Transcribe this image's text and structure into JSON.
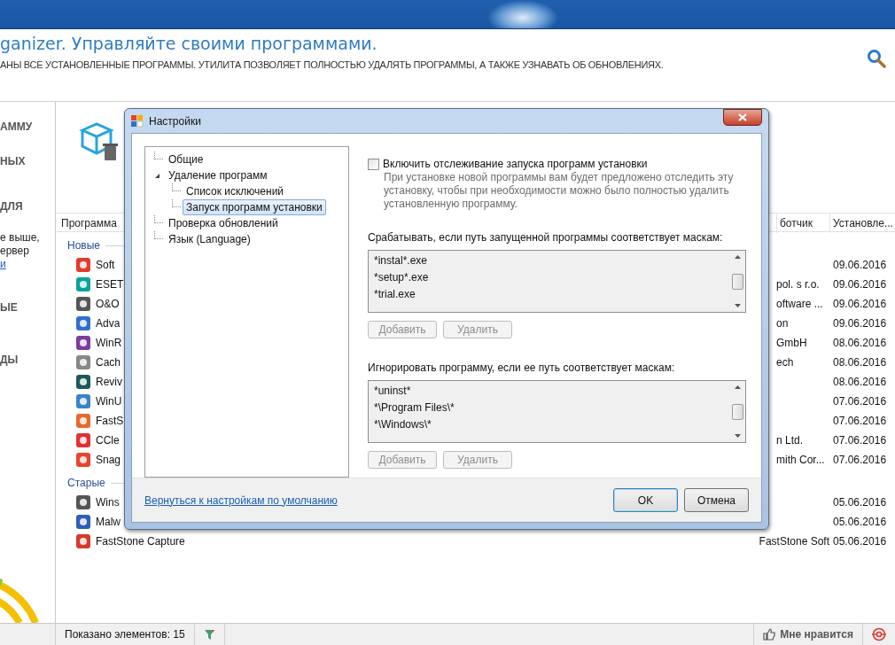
{
  "header": {
    "title": "ganizer. Управляйте своими программами.",
    "subtitle": "АНЫ ВСЕ УСТАНОВЛЕННЫЕ ПРОГРАММЫ. УТИЛИТА ПОЗВОЛЯЕТ ПОЛНОСТЬЮ УДАЛЯТЬ ПРОГРАММЫ, А ТАКЖЕ УЗНАВАТЬ ОБ ОБНОВЛЕНИЯХ."
  },
  "sidebar": {
    "items": [
      {
        "kind": "heading",
        "text": "АММУ"
      },
      {
        "kind": "heading",
        "text": "НЫХ"
      },
      {
        "kind": "heading",
        "text": "ДЛЯ"
      },
      {
        "kind": "text",
        "text": "е выше,"
      },
      {
        "kind": "text",
        "text": "ервер"
      },
      {
        "kind": "link",
        "text": "и"
      },
      {
        "kind": "heading",
        "text": "ЫЕ"
      },
      {
        "kind": "heading",
        "text": "ДЫ"
      }
    ]
  },
  "table": {
    "columns": [
      "Программа",
      "ботчик",
      "Установле..."
    ],
    "groups": [
      {
        "label": "Новые",
        "rows": [
          {
            "name": "Soft",
            "publisher": "",
            "date": "09.06.2016"
          },
          {
            "name": "ESET",
            "publisher": "pol. s r.o.",
            "date": "09.06.2016"
          },
          {
            "name": "O&O",
            "publisher": "oftware ...",
            "date": "09.06.2016"
          },
          {
            "name": "Adva",
            "publisher": "on",
            "date": "09.06.2016"
          },
          {
            "name": "WinR",
            "publisher": "GmbH",
            "date": "08.06.2016"
          },
          {
            "name": "Cach",
            "publisher": "ech",
            "date": "08.06.2016"
          },
          {
            "name": "Reviv",
            "publisher": "",
            "date": "08.06.2016"
          },
          {
            "name": "WinU",
            "publisher": "",
            "date": "07.06.2016"
          },
          {
            "name": "FastS",
            "publisher": "",
            "date": "07.06.2016"
          },
          {
            "name": "CCle",
            "publisher": "n Ltd.",
            "date": "07.06.2016"
          },
          {
            "name": "Snag",
            "publisher": "mith Cor...",
            "date": "07.06.2016"
          }
        ]
      },
      {
        "label": "Старые",
        "rows": [
          {
            "name": "Wins",
            "publisher": "",
            "date": "05.06.2016"
          },
          {
            "name": "Malw",
            "publisher": "",
            "date": "05.06.2016"
          },
          {
            "name": "FastStone Capture",
            "publisher": "FastStone Soft",
            "date": "05.06.2016"
          }
        ]
      }
    ]
  },
  "status_bar": {
    "count": "Показано элементов: 15",
    "like": "Мне нравится"
  },
  "dialog": {
    "title": "Настройки",
    "tree": [
      {
        "label": "Общие",
        "selected": false
      },
      {
        "label": "Удаление программ",
        "selected": false,
        "expanded": true,
        "children": [
          {
            "label": "Список исключений",
            "selected": false
          },
          {
            "label": "Запуск программ установки",
            "selected": true
          }
        ]
      },
      {
        "label": "Проверка обновлений",
        "selected": false
      },
      {
        "label": "Язык (Language)",
        "selected": false
      }
    ],
    "tracking": {
      "label": "Включить отслеживание запуска программ установки",
      "checked": false,
      "description": "При установке новой программы вам будет предложено отследить эту установку, чтобы при необходимости можно было полностью удалить установленную программу."
    },
    "mask_sections": [
      {
        "label": "Срабатывать, если путь запущенной программы соответствует маскам:",
        "items": [
          "*instal*.exe",
          "*setup*.exe",
          "*trial.exe"
        ],
        "buttons": [
          {
            "label": "Добавить",
            "disabled": true
          },
          {
            "label": "Удалить",
            "disabled": true
          }
        ]
      },
      {
        "label": "Игнорировать программу, если ее путь соответствует маскам:",
        "items": [
          "*uninst*",
          "*\\Program Files\\*",
          "*\\Windows\\*"
        ],
        "buttons": [
          {
            "label": "Добавить",
            "disabled": true
          },
          {
            "label": "Удалить",
            "disabled": true
          }
        ]
      }
    ],
    "reset_link": "Вернуться к настройкам по умолчанию",
    "buttons": [
      {
        "label": "OK",
        "default": true
      },
      {
        "label": "Отмена",
        "default": false
      }
    ]
  }
}
